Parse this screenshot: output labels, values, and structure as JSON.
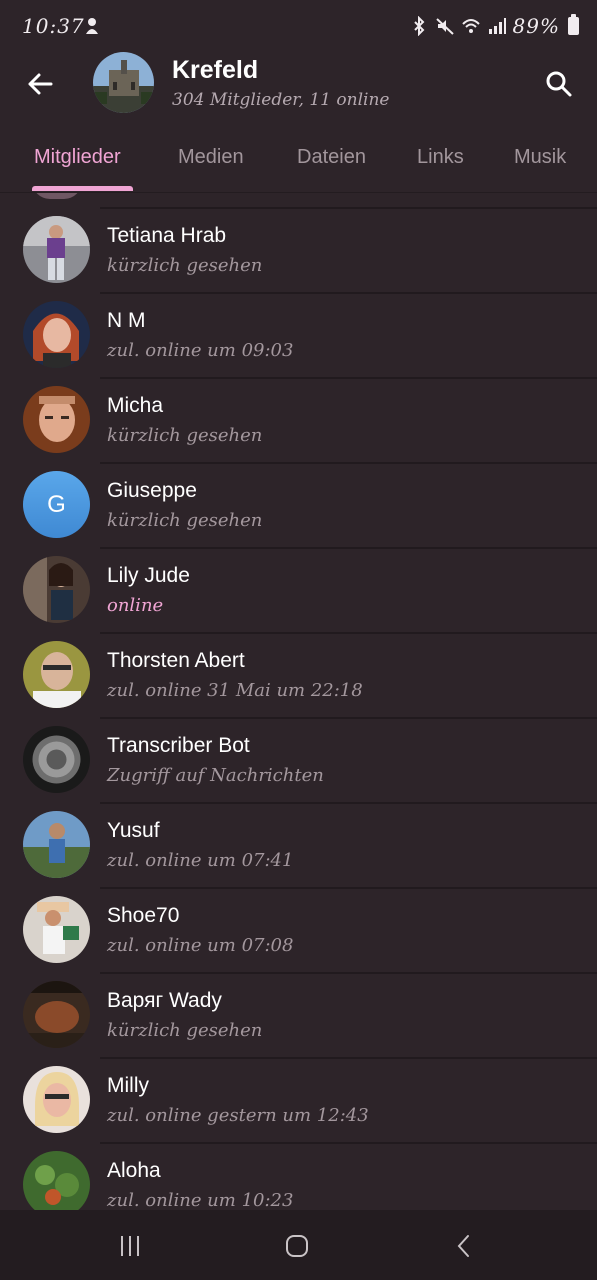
{
  "status_bar": {
    "time": "10:37",
    "battery": "89%",
    "icons": [
      "notification-icon",
      "bluetooth-icon",
      "mute-icon",
      "wifi-icon",
      "signal-icon",
      "battery-icon"
    ]
  },
  "header": {
    "title": "Krefeld",
    "subtitle": "304 Mitglieder, 11 online"
  },
  "tabs": [
    {
      "label": "Mitglieder",
      "active": true
    },
    {
      "label": "Medien",
      "active": false
    },
    {
      "label": "Dateien",
      "active": false
    },
    {
      "label": "Links",
      "active": false
    },
    {
      "label": "Musik",
      "active": false
    }
  ],
  "members": [
    {
      "name": "Tetiana Hrab",
      "status": "kürzlich gesehen",
      "online": false
    },
    {
      "name": "N M",
      "status": "zul. online um 09:03",
      "online": false
    },
    {
      "name": "Micha",
      "status": "kürzlich gesehen",
      "online": false
    },
    {
      "name": "Giuseppe",
      "status": "kürzlich gesehen",
      "online": false,
      "initial": "G"
    },
    {
      "name": "Lily Jude",
      "status": "online",
      "online": true
    },
    {
      "name": "Thorsten Abert",
      "status": "zul. online 31 Mai um 22:18",
      "online": false
    },
    {
      "name": "Transcriber Bot",
      "status": "Zugriff auf Nachrichten",
      "online": false
    },
    {
      "name": "Yusuf",
      "status": "zul. online um 07:41",
      "online": false
    },
    {
      "name": "Shoe70",
      "status": "zul. online um 07:08",
      "online": false
    },
    {
      "name": "Варяг Wady",
      "status": "kürzlich gesehen",
      "online": false
    },
    {
      "name": "Milly",
      "status": "zul. online gestern um 12:43",
      "online": false
    },
    {
      "name": "Aloha",
      "status": "zul. online um 10:23",
      "online": false
    }
  ],
  "colors": {
    "background": "#2d2429",
    "accent": "#f0a5d4",
    "muted_text": "#a3979d",
    "navbar": "#231c20"
  },
  "navbar": {
    "icons": [
      "recent-apps-icon",
      "home-icon",
      "back-nav-icon"
    ]
  }
}
